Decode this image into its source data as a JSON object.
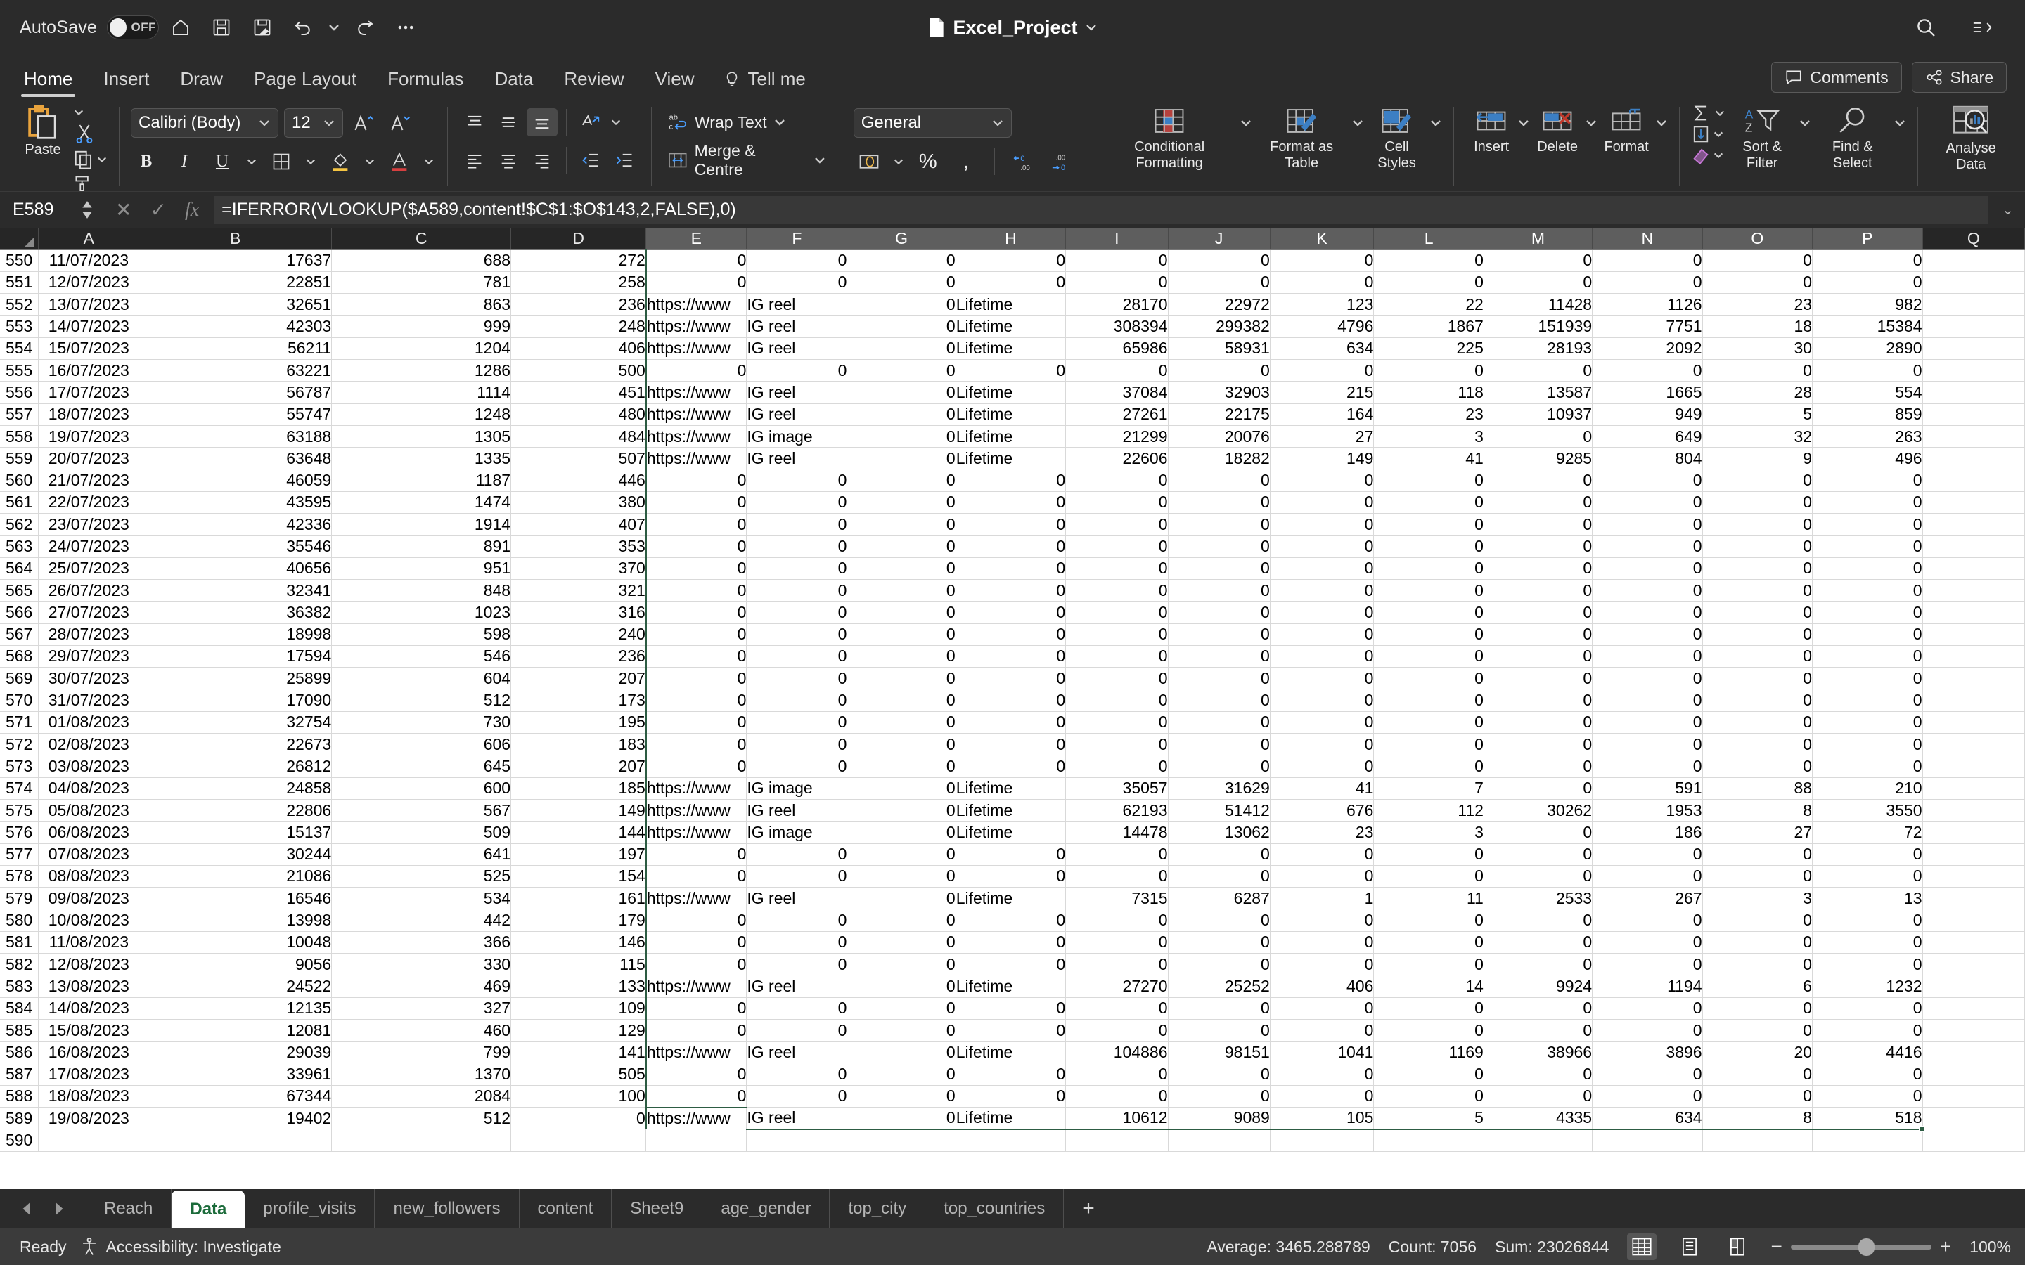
{
  "titlebar": {
    "autosave_label": "AutoSave",
    "autosave_state": "OFF",
    "document_name": "Excel_Project",
    "quick_access": [
      "home-icon",
      "save-icon",
      "save-as-icon",
      "undo-icon",
      "redo-icon",
      "more-icon"
    ],
    "right_icons": [
      "search-icon",
      "ribbon-display-icon"
    ]
  },
  "ribbon": {
    "tabs": [
      {
        "label": "Home",
        "active": true
      },
      {
        "label": "Insert",
        "active": false
      },
      {
        "label": "Draw",
        "active": false
      },
      {
        "label": "Page Layout",
        "active": false
      },
      {
        "label": "Formulas",
        "active": false
      },
      {
        "label": "Data",
        "active": false
      },
      {
        "label": "Review",
        "active": false
      },
      {
        "label": "View",
        "active": false
      }
    ],
    "tell_me": "Tell me",
    "comments_label": "Comments",
    "share_label": "Share",
    "paste_label": "Paste",
    "font_name": "Calibri (Body)",
    "font_size": "12",
    "number_format": "General",
    "wrap_text_label": "Wrap Text",
    "merge_centre_label": "Merge & Centre",
    "conditional_formatting_label": "Conditional Formatting",
    "format_as_table_label": "Format as Table",
    "cell_styles_label": "Cell Styles",
    "insert_label": "Insert",
    "delete_label": "Delete",
    "format_label": "Format",
    "sort_filter_label": "Sort & Filter",
    "find_select_label": "Find & Select",
    "analyse_data_label": "Analyse Data"
  },
  "formula_bar": {
    "name_box": "E589",
    "formula": "=IFERROR(VLOOKUP($A589,content!$C$1:$O$143,2,FALSE),0)",
    "cancel_icon": "x-icon",
    "confirm_icon": "check-icon",
    "function_icon": "fx-icon"
  },
  "grid": {
    "columns": [
      "A",
      "B",
      "C",
      "D",
      "E",
      "F",
      "G",
      "H",
      "I",
      "J",
      "K",
      "L",
      "M",
      "N",
      "O",
      "P",
      "Q"
    ],
    "selected_columns": [
      "E",
      "F",
      "G",
      "H",
      "I",
      "J",
      "K",
      "L",
      "M",
      "N",
      "O",
      "P"
    ],
    "active_cell": "E589",
    "rows": [
      {
        "n": "550",
        "a": "11/07/2023",
        "b": "17637",
        "c": "688",
        "d": "272",
        "e": "0",
        "f": "0",
        "g": "0",
        "h": "0",
        "i": "0",
        "j": "0",
        "k": "0",
        "l": "0",
        "m": "0",
        "n2": "0",
        "o": "0",
        "p": "0"
      },
      {
        "n": "551",
        "a": "12/07/2023",
        "b": "22851",
        "c": "781",
        "d": "258",
        "e": "0",
        "f": "0",
        "g": "0",
        "h": "0",
        "i": "0",
        "j": "0",
        "k": "0",
        "l": "0",
        "m": "0",
        "n2": "0",
        "o": "0",
        "p": "0"
      },
      {
        "n": "552",
        "a": "13/07/2023",
        "b": "32651",
        "c": "863",
        "d": "236",
        "e": "https://www",
        "f": "IG reel",
        "g": "0",
        "h": "Lifetime",
        "i": "28170",
        "j": "22972",
        "k": "123",
        "l": "22",
        "m": "11428",
        "n2": "1126",
        "o": "23",
        "p": "982"
      },
      {
        "n": "553",
        "a": "14/07/2023",
        "b": "42303",
        "c": "999",
        "d": "248",
        "e": "https://www",
        "f": "IG reel",
        "g": "0",
        "h": "Lifetime",
        "i": "308394",
        "j": "299382",
        "k": "4796",
        "l": "1867",
        "m": "151939",
        "n2": "7751",
        "o": "18",
        "p": "15384"
      },
      {
        "n": "554",
        "a": "15/07/2023",
        "b": "56211",
        "c": "1204",
        "d": "406",
        "e": "https://www",
        "f": "IG reel",
        "g": "0",
        "h": "Lifetime",
        "i": "65986",
        "j": "58931",
        "k": "634",
        "l": "225",
        "m": "28193",
        "n2": "2092",
        "o": "30",
        "p": "2890"
      },
      {
        "n": "555",
        "a": "16/07/2023",
        "b": "63221",
        "c": "1286",
        "d": "500",
        "e": "0",
        "f": "0",
        "g": "0",
        "h": "0",
        "i": "0",
        "j": "0",
        "k": "0",
        "l": "0",
        "m": "0",
        "n2": "0",
        "o": "0",
        "p": "0"
      },
      {
        "n": "556",
        "a": "17/07/2023",
        "b": "56787",
        "c": "1114",
        "d": "451",
        "e": "https://www",
        "f": "IG reel",
        "g": "0",
        "h": "Lifetime",
        "i": "37084",
        "j": "32903",
        "k": "215",
        "l": "118",
        "m": "13587",
        "n2": "1665",
        "o": "28",
        "p": "554"
      },
      {
        "n": "557",
        "a": "18/07/2023",
        "b": "55747",
        "c": "1248",
        "d": "480",
        "e": "https://www",
        "f": "IG reel",
        "g": "0",
        "h": "Lifetime",
        "i": "27261",
        "j": "22175",
        "k": "164",
        "l": "23",
        "m": "10937",
        "n2": "949",
        "o": "5",
        "p": "859"
      },
      {
        "n": "558",
        "a": "19/07/2023",
        "b": "63188",
        "c": "1305",
        "d": "484",
        "e": "https://www",
        "f": "IG image",
        "g": "0",
        "h": "Lifetime",
        "i": "21299",
        "j": "20076",
        "k": "27",
        "l": "3",
        "m": "0",
        "n2": "649",
        "o": "32",
        "p": "263"
      },
      {
        "n": "559",
        "a": "20/07/2023",
        "b": "63648",
        "c": "1335",
        "d": "507",
        "e": "https://www",
        "f": "IG reel",
        "g": "0",
        "h": "Lifetime",
        "i": "22606",
        "j": "18282",
        "k": "149",
        "l": "41",
        "m": "9285",
        "n2": "804",
        "o": "9",
        "p": "496"
      },
      {
        "n": "560",
        "a": "21/07/2023",
        "b": "46059",
        "c": "1187",
        "d": "446",
        "e": "0",
        "f": "0",
        "g": "0",
        "h": "0",
        "i": "0",
        "j": "0",
        "k": "0",
        "l": "0",
        "m": "0",
        "n2": "0",
        "o": "0",
        "p": "0"
      },
      {
        "n": "561",
        "a": "22/07/2023",
        "b": "43595",
        "c": "1474",
        "d": "380",
        "e": "0",
        "f": "0",
        "g": "0",
        "h": "0",
        "i": "0",
        "j": "0",
        "k": "0",
        "l": "0",
        "m": "0",
        "n2": "0",
        "o": "0",
        "p": "0"
      },
      {
        "n": "562",
        "a": "23/07/2023",
        "b": "42336",
        "c": "1914",
        "d": "407",
        "e": "0",
        "f": "0",
        "g": "0",
        "h": "0",
        "i": "0",
        "j": "0",
        "k": "0",
        "l": "0",
        "m": "0",
        "n2": "0",
        "o": "0",
        "p": "0"
      },
      {
        "n": "563",
        "a": "24/07/2023",
        "b": "35546",
        "c": "891",
        "d": "353",
        "e": "0",
        "f": "0",
        "g": "0",
        "h": "0",
        "i": "0",
        "j": "0",
        "k": "0",
        "l": "0",
        "m": "0",
        "n2": "0",
        "o": "0",
        "p": "0"
      },
      {
        "n": "564",
        "a": "25/07/2023",
        "b": "40656",
        "c": "951",
        "d": "370",
        "e": "0",
        "f": "0",
        "g": "0",
        "h": "0",
        "i": "0",
        "j": "0",
        "k": "0",
        "l": "0",
        "m": "0",
        "n2": "0",
        "o": "0",
        "p": "0"
      },
      {
        "n": "565",
        "a": "26/07/2023",
        "b": "32341",
        "c": "848",
        "d": "321",
        "e": "0",
        "f": "0",
        "g": "0",
        "h": "0",
        "i": "0",
        "j": "0",
        "k": "0",
        "l": "0",
        "m": "0",
        "n2": "0",
        "o": "0",
        "p": "0"
      },
      {
        "n": "566",
        "a": "27/07/2023",
        "b": "36382",
        "c": "1023",
        "d": "316",
        "e": "0",
        "f": "0",
        "g": "0",
        "h": "0",
        "i": "0",
        "j": "0",
        "k": "0",
        "l": "0",
        "m": "0",
        "n2": "0",
        "o": "0",
        "p": "0"
      },
      {
        "n": "567",
        "a": "28/07/2023",
        "b": "18998",
        "c": "598",
        "d": "240",
        "e": "0",
        "f": "0",
        "g": "0",
        "h": "0",
        "i": "0",
        "j": "0",
        "k": "0",
        "l": "0",
        "m": "0",
        "n2": "0",
        "o": "0",
        "p": "0"
      },
      {
        "n": "568",
        "a": "29/07/2023",
        "b": "17594",
        "c": "546",
        "d": "236",
        "e": "0",
        "f": "0",
        "g": "0",
        "h": "0",
        "i": "0",
        "j": "0",
        "k": "0",
        "l": "0",
        "m": "0",
        "n2": "0",
        "o": "0",
        "p": "0"
      },
      {
        "n": "569",
        "a": "30/07/2023",
        "b": "25899",
        "c": "604",
        "d": "207",
        "e": "0",
        "f": "0",
        "g": "0",
        "h": "0",
        "i": "0",
        "j": "0",
        "k": "0",
        "l": "0",
        "m": "0",
        "n2": "0",
        "o": "0",
        "p": "0"
      },
      {
        "n": "570",
        "a": "31/07/2023",
        "b": "17090",
        "c": "512",
        "d": "173",
        "e": "0",
        "f": "0",
        "g": "0",
        "h": "0",
        "i": "0",
        "j": "0",
        "k": "0",
        "l": "0",
        "m": "0",
        "n2": "0",
        "o": "0",
        "p": "0"
      },
      {
        "n": "571",
        "a": "01/08/2023",
        "b": "32754",
        "c": "730",
        "d": "195",
        "e": "0",
        "f": "0",
        "g": "0",
        "h": "0",
        "i": "0",
        "j": "0",
        "k": "0",
        "l": "0",
        "m": "0",
        "n2": "0",
        "o": "0",
        "p": "0"
      },
      {
        "n": "572",
        "a": "02/08/2023",
        "b": "22673",
        "c": "606",
        "d": "183",
        "e": "0",
        "f": "0",
        "g": "0",
        "h": "0",
        "i": "0",
        "j": "0",
        "k": "0",
        "l": "0",
        "m": "0",
        "n2": "0",
        "o": "0",
        "p": "0"
      },
      {
        "n": "573",
        "a": "03/08/2023",
        "b": "26812",
        "c": "645",
        "d": "207",
        "e": "0",
        "f": "0",
        "g": "0",
        "h": "0",
        "i": "0",
        "j": "0",
        "k": "0",
        "l": "0",
        "m": "0",
        "n2": "0",
        "o": "0",
        "p": "0"
      },
      {
        "n": "574",
        "a": "04/08/2023",
        "b": "24858",
        "c": "600",
        "d": "185",
        "e": "https://www",
        "f": "IG image",
        "g": "0",
        "h": "Lifetime",
        "i": "35057",
        "j": "31629",
        "k": "41",
        "l": "7",
        "m": "0",
        "n2": "591",
        "o": "88",
        "p": "210"
      },
      {
        "n": "575",
        "a": "05/08/2023",
        "b": "22806",
        "c": "567",
        "d": "149",
        "e": "https://www",
        "f": "IG reel",
        "g": "0",
        "h": "Lifetime",
        "i": "62193",
        "j": "51412",
        "k": "676",
        "l": "112",
        "m": "30262",
        "n2": "1953",
        "o": "8",
        "p": "3550"
      },
      {
        "n": "576",
        "a": "06/08/2023",
        "b": "15137",
        "c": "509",
        "d": "144",
        "e": "https://www",
        "f": "IG image",
        "g": "0",
        "h": "Lifetime",
        "i": "14478",
        "j": "13062",
        "k": "23",
        "l": "3",
        "m": "0",
        "n2": "186",
        "o": "27",
        "p": "72"
      },
      {
        "n": "577",
        "a": "07/08/2023",
        "b": "30244",
        "c": "641",
        "d": "197",
        "e": "0",
        "f": "0",
        "g": "0",
        "h": "0",
        "i": "0",
        "j": "0",
        "k": "0",
        "l": "0",
        "m": "0",
        "n2": "0",
        "o": "0",
        "p": "0"
      },
      {
        "n": "578",
        "a": "08/08/2023",
        "b": "21086",
        "c": "525",
        "d": "154",
        "e": "0",
        "f": "0",
        "g": "0",
        "h": "0",
        "i": "0",
        "j": "0",
        "k": "0",
        "l": "0",
        "m": "0",
        "n2": "0",
        "o": "0",
        "p": "0"
      },
      {
        "n": "579",
        "a": "09/08/2023",
        "b": "16546",
        "c": "534",
        "d": "161",
        "e": "https://www",
        "f": "IG reel",
        "g": "0",
        "h": "Lifetime",
        "i": "7315",
        "j": "6287",
        "k": "1",
        "l": "11",
        "m": "2533",
        "n2": "267",
        "o": "3",
        "p": "13"
      },
      {
        "n": "580",
        "a": "10/08/2023",
        "b": "13998",
        "c": "442",
        "d": "179",
        "e": "0",
        "f": "0",
        "g": "0",
        "h": "0",
        "i": "0",
        "j": "0",
        "k": "0",
        "l": "0",
        "m": "0",
        "n2": "0",
        "o": "0",
        "p": "0"
      },
      {
        "n": "581",
        "a": "11/08/2023",
        "b": "10048",
        "c": "366",
        "d": "146",
        "e": "0",
        "f": "0",
        "g": "0",
        "h": "0",
        "i": "0",
        "j": "0",
        "k": "0",
        "l": "0",
        "m": "0",
        "n2": "0",
        "o": "0",
        "p": "0"
      },
      {
        "n": "582",
        "a": "12/08/2023",
        "b": "9056",
        "c": "330",
        "d": "115",
        "e": "0",
        "f": "0",
        "g": "0",
        "h": "0",
        "i": "0",
        "j": "0",
        "k": "0",
        "l": "0",
        "m": "0",
        "n2": "0",
        "o": "0",
        "p": "0"
      },
      {
        "n": "583",
        "a": "13/08/2023",
        "b": "24522",
        "c": "469",
        "d": "133",
        "e": "https://www",
        "f": "IG reel",
        "g": "0",
        "h": "Lifetime",
        "i": "27270",
        "j": "25252",
        "k": "406",
        "l": "14",
        "m": "9924",
        "n2": "1194",
        "o": "6",
        "p": "1232"
      },
      {
        "n": "584",
        "a": "14/08/2023",
        "b": "12135",
        "c": "327",
        "d": "109",
        "e": "0",
        "f": "0",
        "g": "0",
        "h": "0",
        "i": "0",
        "j": "0",
        "k": "0",
        "l": "0",
        "m": "0",
        "n2": "0",
        "o": "0",
        "p": "0"
      },
      {
        "n": "585",
        "a": "15/08/2023",
        "b": "12081",
        "c": "460",
        "d": "129",
        "e": "0",
        "f": "0",
        "g": "0",
        "h": "0",
        "i": "0",
        "j": "0",
        "k": "0",
        "l": "0",
        "m": "0",
        "n2": "0",
        "o": "0",
        "p": "0"
      },
      {
        "n": "586",
        "a": "16/08/2023",
        "b": "29039",
        "c": "799",
        "d": "141",
        "e": "https://www",
        "f": "IG reel",
        "g": "0",
        "h": "Lifetime",
        "i": "104886",
        "j": "98151",
        "k": "1041",
        "l": "1169",
        "m": "38966",
        "n2": "3896",
        "o": "20",
        "p": "4416"
      },
      {
        "n": "587",
        "a": "17/08/2023",
        "b": "33961",
        "c": "1370",
        "d": "505",
        "e": "0",
        "f": "0",
        "g": "0",
        "h": "0",
        "i": "0",
        "j": "0",
        "k": "0",
        "l": "0",
        "m": "0",
        "n2": "0",
        "o": "0",
        "p": "0"
      },
      {
        "n": "588",
        "a": "18/08/2023",
        "b": "67344",
        "c": "2084",
        "d": "100",
        "e": "0",
        "f": "0",
        "g": "0",
        "h": "0",
        "i": "0",
        "j": "0",
        "k": "0",
        "l": "0",
        "m": "0",
        "n2": "0",
        "o": "0",
        "p": "0"
      },
      {
        "n": "589",
        "a": "19/08/2023",
        "b": "19402",
        "c": "512",
        "d": "0",
        "e": "https://www",
        "f": "IG reel",
        "g": "0",
        "h": "Lifetime",
        "i": "10612",
        "j": "9089",
        "k": "105",
        "l": "5",
        "m": "4335",
        "n2": "634",
        "o": "8",
        "p": "518"
      },
      {
        "n": "590",
        "a": "",
        "b": "",
        "c": "",
        "d": "",
        "e": "",
        "f": "",
        "g": "",
        "h": "",
        "i": "",
        "j": "",
        "k": "",
        "l": "",
        "m": "",
        "n2": "",
        "o": "",
        "p": ""
      }
    ]
  },
  "sheet_tabs": {
    "tabs": [
      {
        "label": "Reach",
        "active": false
      },
      {
        "label": "Data",
        "active": true
      },
      {
        "label": "profile_visits",
        "active": false
      },
      {
        "label": "new_followers",
        "active": false
      },
      {
        "label": "content",
        "active": false
      },
      {
        "label": "Sheet9",
        "active": false
      },
      {
        "label": "age_gender",
        "active": false
      },
      {
        "label": "top_city",
        "active": false
      },
      {
        "label": "top_countries",
        "active": false
      }
    ],
    "add_label": "+"
  },
  "status_bar": {
    "state": "Ready",
    "accessibility": "Accessibility: Investigate",
    "average": "Average: 3465.288789",
    "count": "Count: 7056",
    "sum": "Sum: 23026844",
    "zoom": "100%",
    "zoom_out": "−",
    "zoom_in": "+"
  },
  "colors": {
    "chrome": "#2b2b2b",
    "accent_green": "#2d5c43",
    "selection_fill": "#c9c9c9",
    "active_tab_text": "#1b6b3a"
  }
}
